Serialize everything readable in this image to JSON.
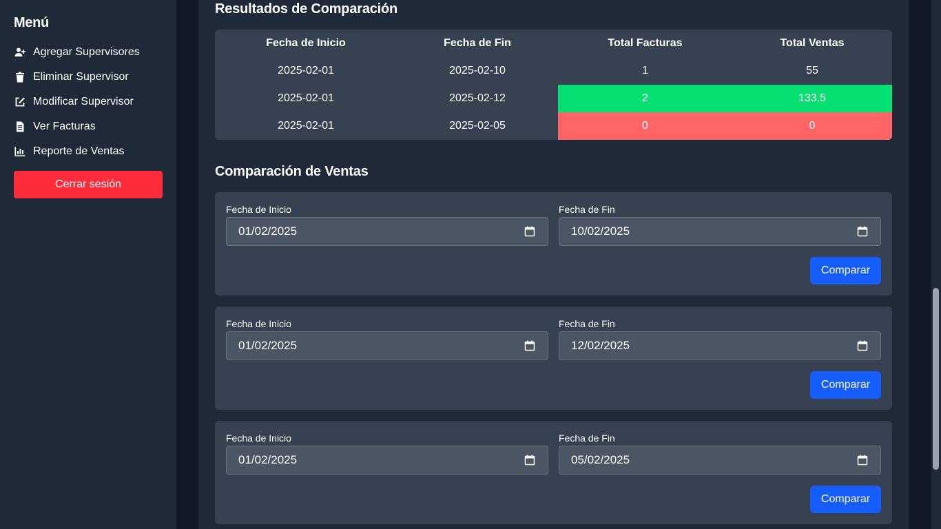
{
  "sidebar": {
    "title": "Menú",
    "items": [
      {
        "label": "Agregar Supervisores",
        "icon": "user-plus-icon"
      },
      {
        "label": "Eliminar Supervisor",
        "icon": "trash-icon"
      },
      {
        "label": "Modificar Supervisor",
        "icon": "edit-icon"
      },
      {
        "label": "Ver Facturas",
        "icon": "invoice-icon"
      },
      {
        "label": "Reporte de Ventas",
        "icon": "bar-chart-icon"
      }
    ],
    "logout_label": "Cerrar sesión"
  },
  "results": {
    "title": "Resultados de Comparación",
    "columns": [
      "Fecha de Inicio",
      "Fecha de Fin",
      "Total Facturas",
      "Total Ventas"
    ],
    "rows": [
      {
        "start": "2025-02-01",
        "end": "2025-02-10",
        "invoices": "1",
        "sales": "55",
        "status": "neutral"
      },
      {
        "start": "2025-02-01",
        "end": "2025-02-12",
        "invoices": "2",
        "sales": "133.5",
        "status": "highest"
      },
      {
        "start": "2025-02-01",
        "end": "2025-02-05",
        "invoices": "0",
        "sales": "0",
        "status": "lowest"
      }
    ]
  },
  "comparison": {
    "title": "Comparación de Ventas",
    "start_label": "Fecha de Inicio",
    "end_label": "Fecha de Fin",
    "button_label": "Comparar",
    "forms": [
      {
        "start": "01/02/2025",
        "end": "10/02/2025"
      },
      {
        "start": "01/02/2025",
        "end": "12/02/2025"
      },
      {
        "start": "01/02/2025",
        "end": "05/02/2025"
      }
    ]
  },
  "colors": {
    "highest": "#06df72",
    "lowest": "#ff6467",
    "logout": "#ff2d3b",
    "primary_button": "#155dfc"
  }
}
